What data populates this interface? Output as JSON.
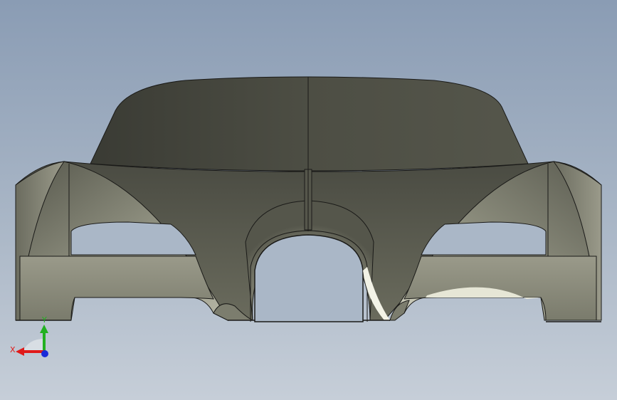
{
  "viewport": {
    "background_top": "#8a9cb4",
    "background_bottom": "#c6ced8"
  },
  "model": {
    "description_icon": "car-body-shell-icon",
    "surface_dark": "#3e3f38",
    "surface_mid": "#7d7e6f",
    "surface_light": "#dcdccc",
    "edge_color": "#1a1a18"
  },
  "triad": {
    "x_label": "X",
    "y_label": "Y",
    "x_color": "#e01a1a",
    "y_color": "#22b020",
    "z_color": "#1a2ad8"
  }
}
